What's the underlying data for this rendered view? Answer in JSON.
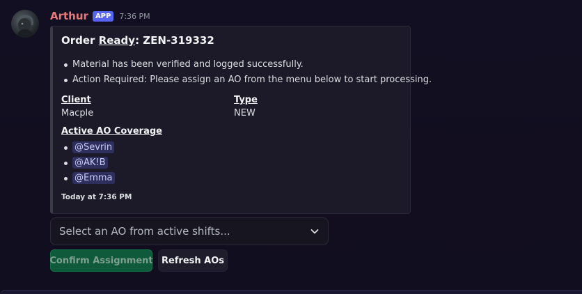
{
  "message": {
    "author": "Arthur",
    "badge": "APP",
    "time": "7:36 PM"
  },
  "embed": {
    "title_prefix": "Order ",
    "title_underlined": "Ready",
    "title_suffix": ": ZEN-319332",
    "bullets": [
      "Material has been verified and logged successfully.",
      "Action Required: Please assign an AO from the menu below to start processing."
    ],
    "fields": {
      "client_name": "Client",
      "client_value": "Macple",
      "type_name": "Type",
      "type_value": "NEW"
    },
    "coverage_title": "Active AO Coverage",
    "mentions": [
      "@Sevrin",
      "@AK!B",
      "@Emma"
    ],
    "footer": "Today at 7:36 PM"
  },
  "select": {
    "placeholder": "Select an AO from active shifts...",
    "icon": "chevron-down-icon"
  },
  "buttons": {
    "confirm": "Confirm Assignment",
    "refresh": "Refresh AOs"
  },
  "colors": {
    "username": "#e8797b",
    "badge": "#5865f2",
    "confirm_bg": "#0f5a3b",
    "mention_bg": "#2e2f5c"
  }
}
